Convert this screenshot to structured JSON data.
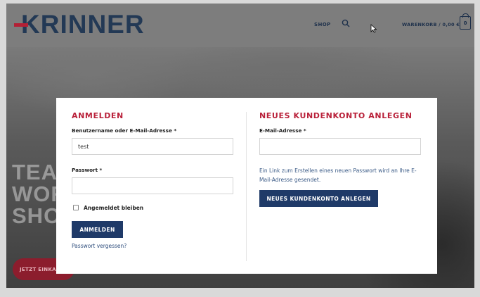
{
  "header": {
    "logo_text": "KRINNER",
    "nav_shop": "SHOP",
    "cart_label": "WARENKORB / 0,00 €",
    "cart_count": "0"
  },
  "hero": {
    "lines": [
      "TEA",
      "WOR",
      "SHO"
    ],
    "cta": "JETZT EINKAU"
  },
  "login": {
    "heading": "ANMELDEN",
    "username_label": "Benutzername oder E-Mail-Adresse *",
    "username_value": "test",
    "password_label": "Passwort *",
    "password_value": "",
    "remember_label": "Angemeldet bleiben",
    "remember_checked": false,
    "submit_label": "ANMELDEN",
    "forgot_link": "Passwort vergessen?"
  },
  "register": {
    "heading": "NEUES KUNDENKONTO ANLEGEN",
    "email_label": "E-Mail-Adresse *",
    "email_value": "",
    "info_text": "Ein Link zum Erstellen eines neuen Passwort wird an Ihre E-Mail-Adresse gesendet.",
    "submit_label": "NEUES KUNDENKONTO ANLEGEN"
  },
  "colors": {
    "accent_red": "#b9213a",
    "brand_navy": "#1f3a68"
  }
}
